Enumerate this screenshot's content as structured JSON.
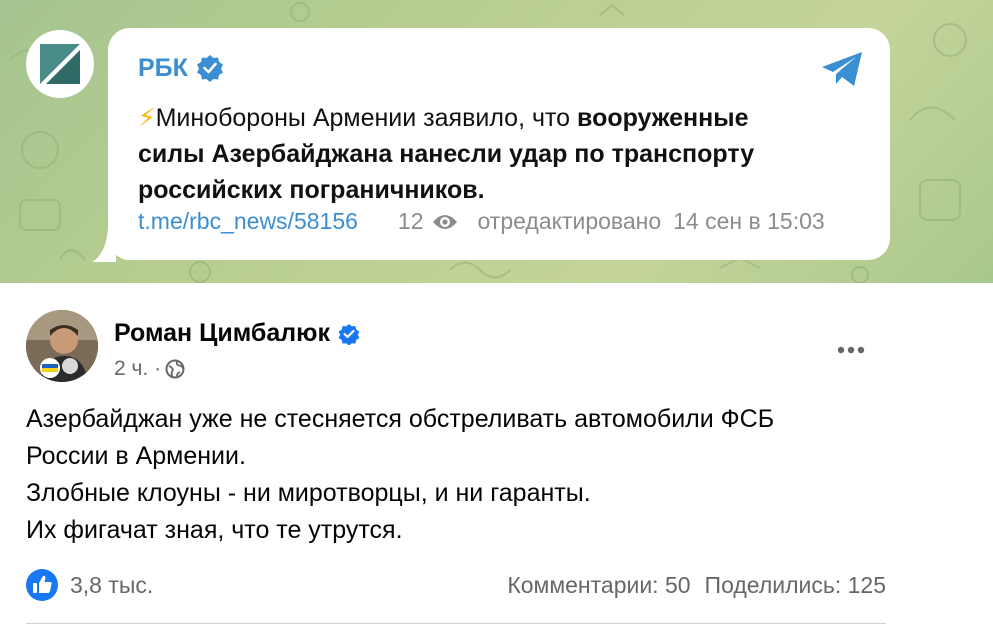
{
  "telegram": {
    "channel_name": "РБК",
    "message_lightning": "⚡",
    "message_plain": "Минобороны Армении заявило, что ",
    "message_bold_1": "вооруженные",
    "message_bold_2": "силы Азербайджана нанесли удар по транспорту",
    "message_bold_3": "российских пограничников.",
    "link": "t.me/rbc_news/58156",
    "views": "12",
    "edited_label": "отредактировано",
    "date": "14 сен в 15:03",
    "colors": {
      "accent": "#3b8ed1",
      "background": "#b9cf8f"
    }
  },
  "facebook": {
    "author_name": "Роман Цимбалюк",
    "time": "2 ч. ·",
    "post_lines": [
      "Азербайджан уже не стесняется обстреливать автомобили ФСБ",
      "России в Армении.",
      "Злобные клоуны - ни миротворцы, и ни гаранты.",
      "Их фигачат зная, что те утрутся."
    ],
    "reactions_count": "3,8 тыс.",
    "comments": "Комментарии: 50",
    "shares": "Поделились: 125",
    "colors": {
      "like_blue": "#1877f2",
      "verified_blue": "#1877f2"
    }
  }
}
